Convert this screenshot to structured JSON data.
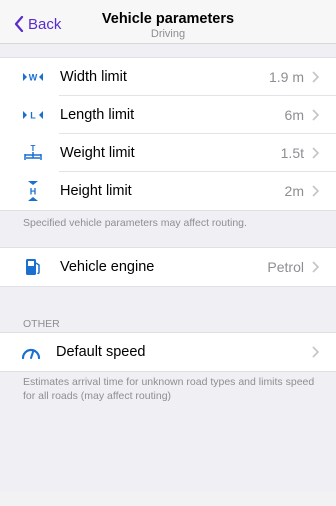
{
  "navbar": {
    "back_label": "Back",
    "title": "Vehicle parameters",
    "subtitle": "Driving"
  },
  "accent_color": "#5a2ccc",
  "icon_color": "#1a6fd0",
  "limits": [
    {
      "icon": "width-limit-icon",
      "label": "Width limit",
      "value": "1.9 m"
    },
    {
      "icon": "length-limit-icon",
      "label": "Length limit",
      "value": "6m"
    },
    {
      "icon": "weight-limit-icon",
      "label": "Weight limit",
      "value": "1.5t"
    },
    {
      "icon": "height-limit-icon",
      "label": "Height limit",
      "value": "2m"
    }
  ],
  "limits_note": "Specified vehicle parameters may affect routing.",
  "engine": {
    "icon": "fuel-pump-icon",
    "label": "Vehicle engine",
    "value": "Petrol"
  },
  "other": {
    "header": "OTHER",
    "default_speed": {
      "icon": "speedometer-icon",
      "label": "Default speed",
      "value": ""
    },
    "note": "Estimates arrival time for unknown road types and limits speed for all roads (may affect routing)"
  }
}
